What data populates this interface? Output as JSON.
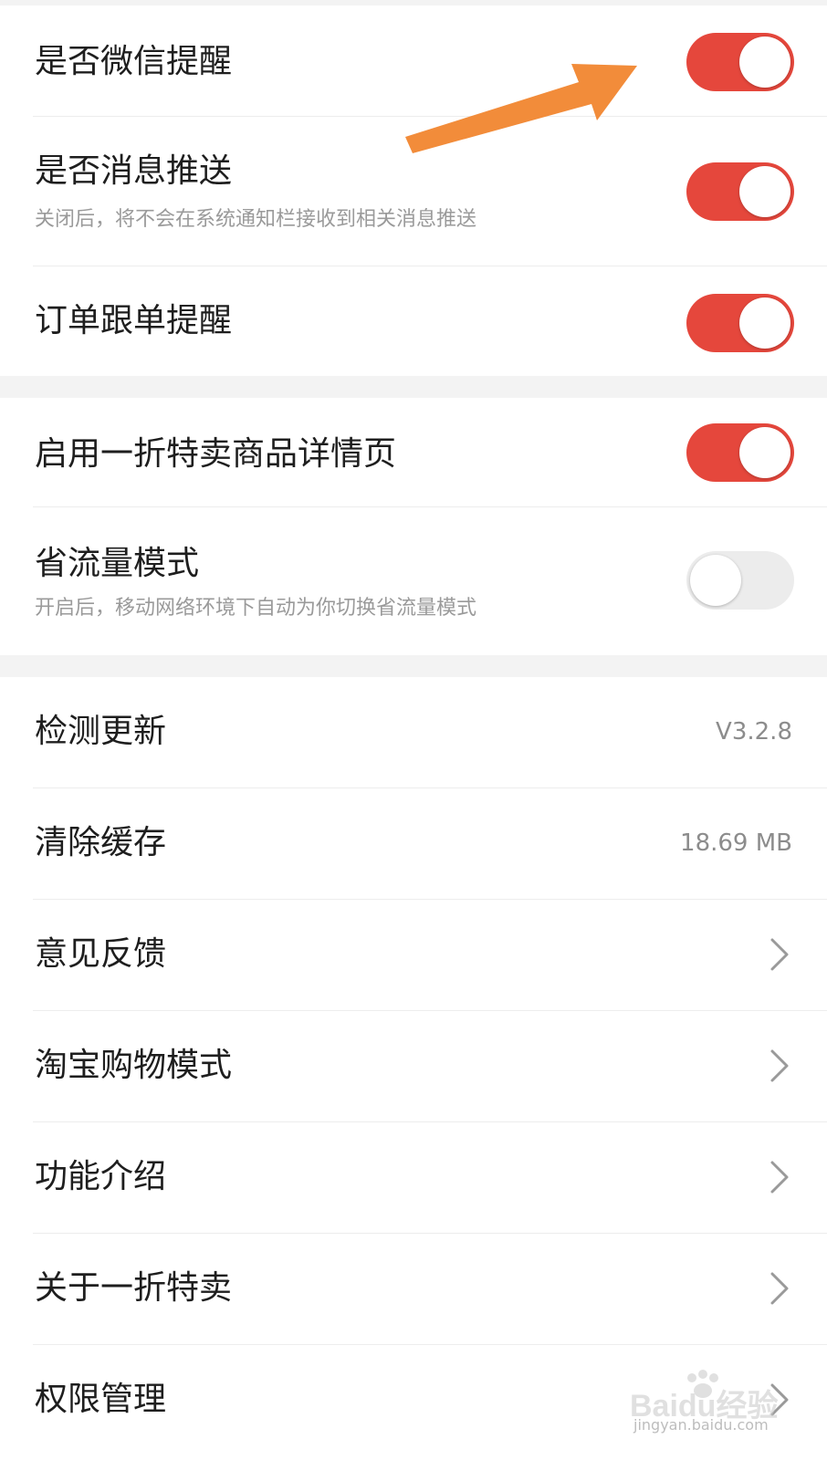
{
  "sections": [
    {
      "items": [
        {
          "title": "是否微信提醒",
          "subtitle": "",
          "toggle": true
        },
        {
          "title": "是否消息推送",
          "subtitle": "关闭后，将不会在系统通知栏接收到相关消息推送",
          "toggle": true
        },
        {
          "title": "订单跟单提醒",
          "subtitle": "",
          "toggle": true
        }
      ]
    },
    {
      "items": [
        {
          "title": "启用一折特卖商品详情页",
          "subtitle": "",
          "toggle": true
        },
        {
          "title": "省流量模式",
          "subtitle": "开启后，移动网络环境下自动为你切换省流量模式",
          "toggle": false
        }
      ]
    },
    {
      "items": [
        {
          "title": "检测更新",
          "value": "V3.2.8"
        },
        {
          "title": "清除缓存",
          "value": "18.69 MB"
        },
        {
          "title": "意见反馈",
          "chevron": true
        },
        {
          "title": "淘宝购物模式",
          "chevron": true
        },
        {
          "title": "功能介绍",
          "chevron": true
        },
        {
          "title": "关于一折特卖",
          "chevron": true
        },
        {
          "title": "权限管理",
          "chevron": true
        }
      ]
    }
  ],
  "colors": {
    "toggle_on": "#e5473c",
    "toggle_off": "#ececec",
    "annotation_arrow": "#f28c3a"
  },
  "icons": {
    "chevron": "chevron-right-icon",
    "annotation": "orange-arrow-icon"
  },
  "watermark": {
    "brand": "Baidu经验",
    "url": "jingyan.baidu.com"
  }
}
